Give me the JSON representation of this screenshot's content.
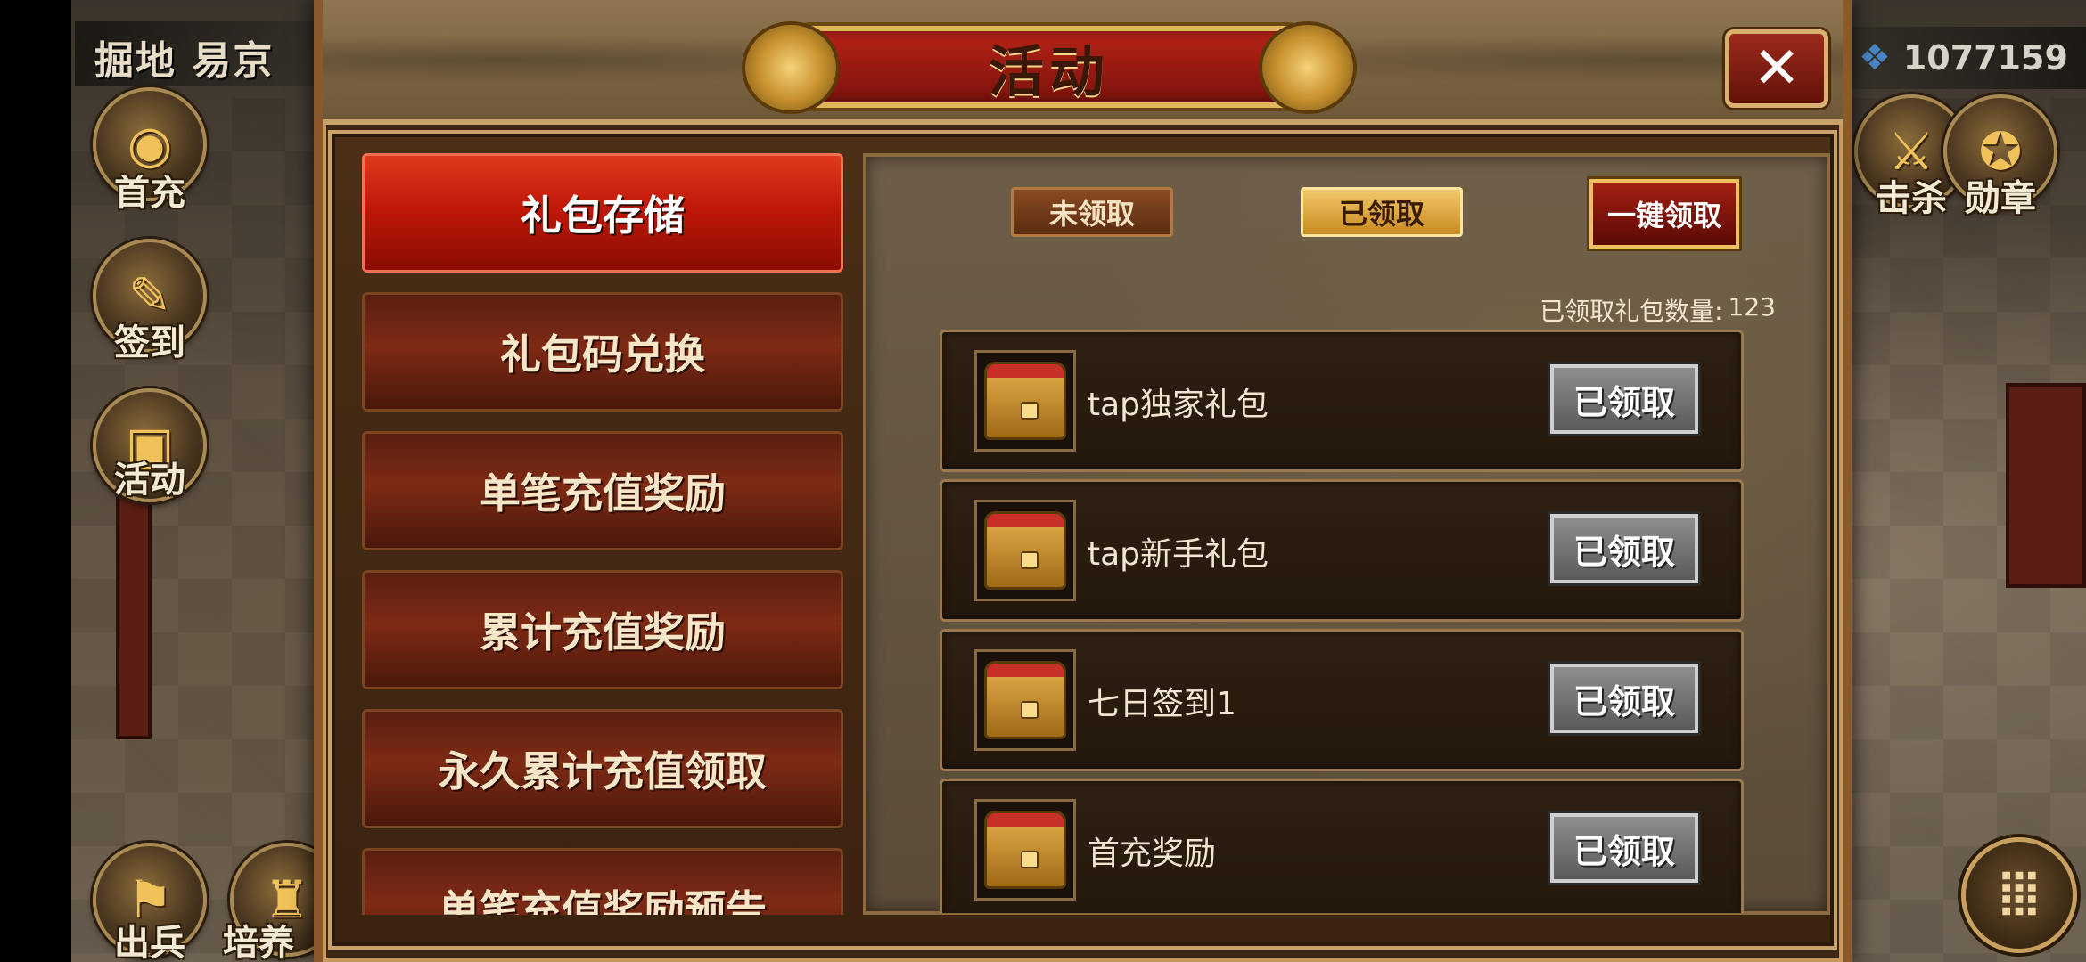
{
  "location": "掘地 易京",
  "currency": {
    "icon": "gem-icon",
    "value": "1077159"
  },
  "left_icons": [
    {
      "label": "首充",
      "icon": "gold-coins-icon"
    },
    {
      "label": "签到",
      "icon": "scroll-quill-icon"
    },
    {
      "label": "活动",
      "icon": "treasure-chest-icon"
    },
    {
      "label": "出兵",
      "icon": "war-flag-icon"
    },
    {
      "label": "培养",
      "icon": "bronze-vessel-icon"
    }
  ],
  "right_icons": [
    {
      "label": "击杀",
      "icon": "crossed-swords-icon"
    },
    {
      "label": "勋章",
      "icon": "medal-icon"
    }
  ],
  "dialog": {
    "title": "活动",
    "close_icon": "close-icon"
  },
  "tabs": [
    {
      "label": "礼包存储",
      "active": true
    },
    {
      "label": "礼包码兑换",
      "active": false
    },
    {
      "label": "单笔充值奖励",
      "active": false
    },
    {
      "label": "累计充值奖励",
      "active": false
    },
    {
      "label": "永久累计充值领取",
      "active": false
    },
    {
      "label": "单笔充值奖励预告",
      "active": false
    }
  ],
  "filters": {
    "unclaimed": "未领取",
    "claimed": "已领取",
    "claim_all": "一键领取"
  },
  "claimed_count": {
    "label": "已领取礼包数量:",
    "value": "123"
  },
  "gifts": [
    {
      "name": "tap独家礼包",
      "status": "已领取"
    },
    {
      "name": "tap新手礼包",
      "status": "已领取"
    },
    {
      "name": "七日签到1",
      "status": "已领取"
    },
    {
      "name": "首充奖励",
      "status": "已领取"
    }
  ],
  "menu_icon": "menu-grid-icon",
  "colors": {
    "active_tab": "#c01808",
    "claimed_filter": "#f2c867",
    "claim_all": "#a42014",
    "claimed_button": "#8e8e8e"
  }
}
